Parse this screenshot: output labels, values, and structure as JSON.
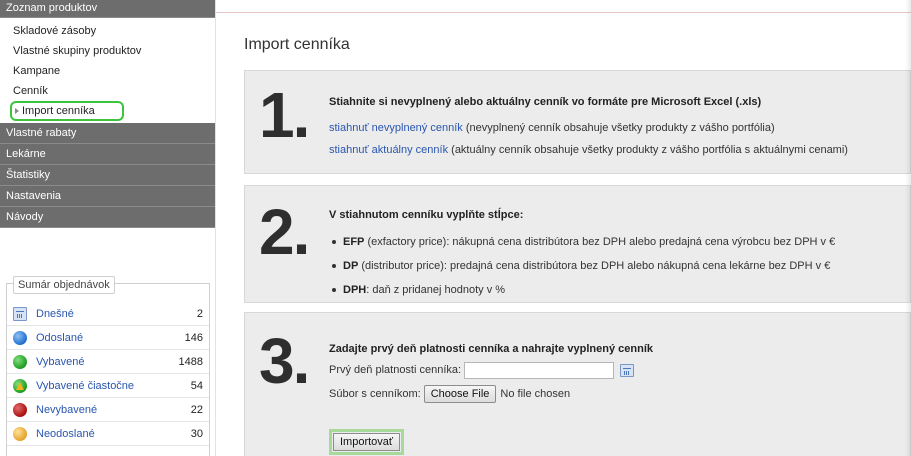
{
  "sidebar": {
    "product_list_header": "Zoznam produktov",
    "submenu": [
      {
        "label": "Skladové zásoby"
      },
      {
        "label": "Vlastné skupiny produktov"
      },
      {
        "label": "Kampane"
      },
      {
        "label": "Cenník"
      },
      {
        "label": "Import cenníka"
      }
    ],
    "sections": [
      "Vlastné rabaty",
      "Lekárne",
      "Štatistiky",
      "Nastavenia",
      "Návody"
    ],
    "summary": {
      "legend": "Sumár objednávok",
      "rows": [
        {
          "label": "Dnešné",
          "count": "2",
          "icon": "calendar-icon"
        },
        {
          "label": "Odoslané",
          "count": "146",
          "icon": "blue-dot-icon"
        },
        {
          "label": "Vybavené",
          "count": "1488",
          "icon": "green-dot-icon"
        },
        {
          "label": "Vybavené čiastočne",
          "count": "54",
          "icon": "warning-dot-icon"
        },
        {
          "label": "Nevybavené",
          "count": "22",
          "icon": "red-dot-icon"
        },
        {
          "label": "Neodoslané",
          "count": "30",
          "icon": "orange-dot-icon"
        }
      ]
    }
  },
  "main": {
    "title": "Import cenníka",
    "step1": {
      "number": "1.",
      "heading": "Stiahnite si nevyplnený alebo aktuálny cenník vo formáte pre Microsoft Excel (.xls)",
      "link1": "stiahnuť nevyplnený cenník",
      "link1_desc": " (nevyplnený cenník obsahuje všetky produkty z vášho portfólia)",
      "link2": "stiahnuť aktuálny cenník",
      "link2_desc": " (aktuálny cenník obsahuje všetky produkty z vášho portfólia s aktuálnymi cenami)"
    },
    "step2": {
      "number": "2.",
      "heading": "V stiahnutom cenníku vyplňte stĺpce:",
      "bullets": [
        {
          "key": "EFP",
          "text": " (exfactory price): nákupná cena distribútora bez DPH alebo predajná cena výrobcu bez DPH v €"
        },
        {
          "key": "DP",
          "text": " (distributor price): predajná cena distribútora bez DPH alebo nákupná cena lekárne bez DPH v €"
        },
        {
          "key": "DPH",
          "text": ": daň z pridanej hodnoty v %"
        }
      ]
    },
    "step3": {
      "number": "3.",
      "heading": "Zadajte prvý deň platnosti cenníka a nahrajte vyplnený cenník",
      "date_label": "Prvý deň platnosti cenníka:",
      "date_value": "",
      "file_label": "Súbor s cenníkom:",
      "choose_file": "Choose File",
      "no_file": "No file chosen",
      "import_button": "Importovať"
    }
  }
}
